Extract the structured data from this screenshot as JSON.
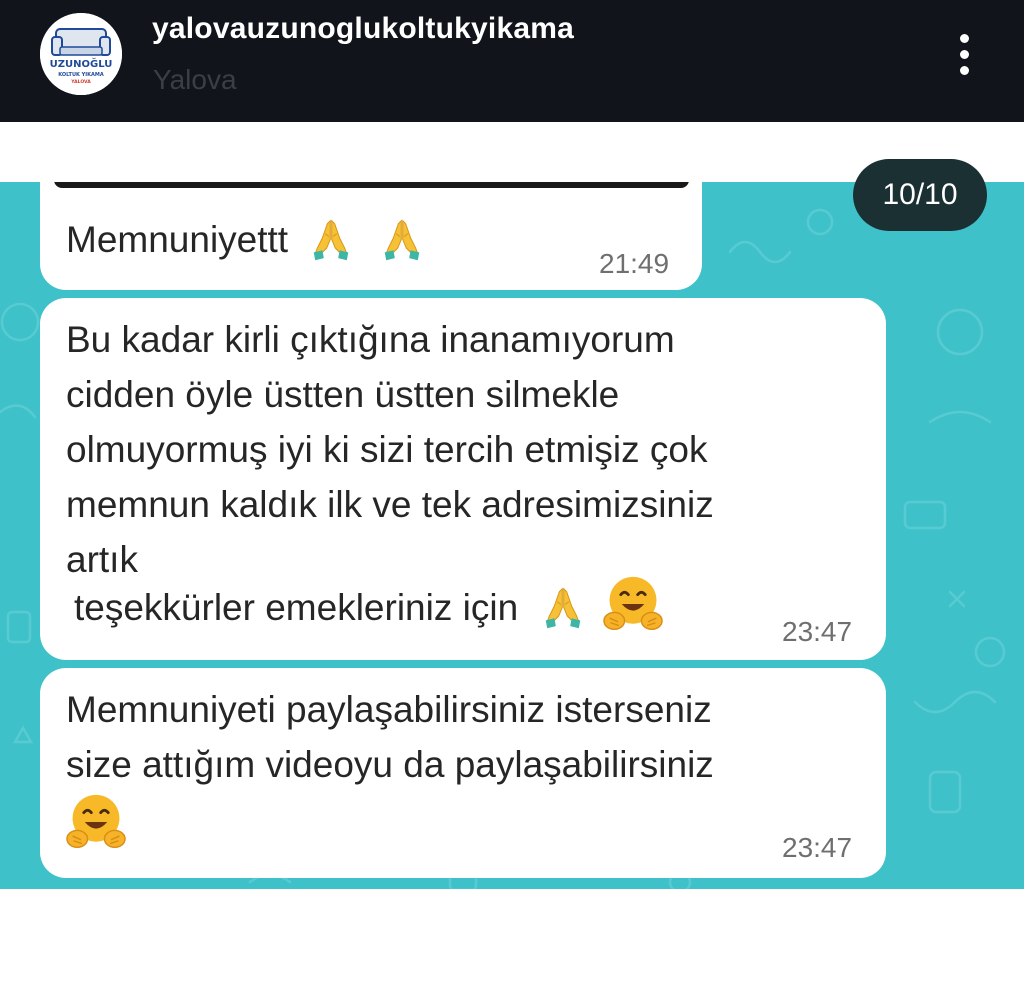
{
  "header": {
    "username": "yalovauzunoglukoltukyikama",
    "location": "Yalova",
    "avatar_logo": {
      "title": "UZUNOĞLU",
      "subtitle": "KOLTUK YIKAMA",
      "city": "YALOVA"
    },
    "more_icon": "more-vertical-icon"
  },
  "story": {
    "counter": "10/10"
  },
  "messages": [
    {
      "lines": [
        "Memnuniyettt"
      ],
      "emojis": [
        "folded-hands-icon",
        "folded-hands-icon"
      ],
      "time": "21:49"
    },
    {
      "lines": [
        "Bu kadar kirli çıktığına inanamıyorum",
        "cidden öyle üstten üstten silmekle",
        "olmuyormuş iyi ki sizi tercih etmişiz çok",
        "memnun kaldık ilk ve tek adresimizsiniz",
        "artık",
        "teşekkürler emekleriniz için"
      ],
      "emojis": [
        "folded-hands-icon",
        "hugging-face-icon"
      ],
      "time": "23:47"
    },
    {
      "lines": [
        "Memnuniyeti paylaşabilirsiniz isterseniz",
        "size attığım videoyu da paylaşabilirsiniz"
      ],
      "emojis": [
        "hugging-face-icon"
      ],
      "time": "23:47"
    }
  ],
  "colors": {
    "header_bg": "#11151b",
    "chat_bg": "#3fc1c9",
    "bubble_bg": "#ffffff",
    "counter_bg": "#1b3033"
  }
}
